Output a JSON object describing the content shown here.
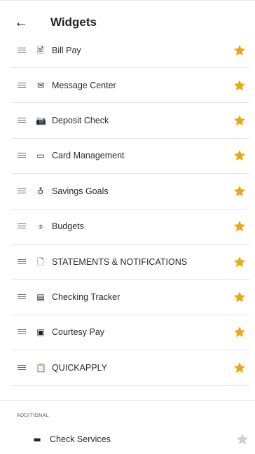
{
  "header": {
    "title": "Widgets",
    "back_icon": "arrow-left-icon"
  },
  "colors": {
    "star_active": "#E8A917",
    "star_inactive": "#CFCFCF",
    "divider": "#E2E2E2"
  },
  "widgets": [
    {
      "label": "Bill Pay",
      "icon": "bill-pay-icon",
      "glyph": "🖹",
      "favorite": true
    },
    {
      "label": "Message Center",
      "icon": "envelope-icon",
      "glyph": "✉",
      "favorite": true
    },
    {
      "label": "Deposit Check",
      "icon": "camera-icon",
      "glyph": "📷",
      "favorite": true
    },
    {
      "label": "Card Management",
      "icon": "credit-card-icon",
      "glyph": "▭",
      "favorite": true
    },
    {
      "label": "Savings Goals",
      "icon": "piggy-bank-icon",
      "glyph": "♁",
      "favorite": true
    },
    {
      "label": "Budgets",
      "icon": "budget-icon",
      "glyph": "⌽",
      "favorite": true
    },
    {
      "label": "STATEMENTS & NOTIFICATIONS",
      "icon": "document-icon",
      "glyph": "🗋",
      "favorite": true
    },
    {
      "label": "Checking Tracker",
      "icon": "tracker-icon",
      "glyph": "▤",
      "favorite": true
    },
    {
      "label": "Courtesy Pay",
      "icon": "money-icon",
      "glyph": "▣",
      "favorite": true
    },
    {
      "label": "QUICKAPPLY",
      "icon": "clipboard-icon",
      "glyph": "📋",
      "favorite": true
    }
  ],
  "additional": {
    "section_label": "ADDITIONAL",
    "items": [
      {
        "label": "Check Services",
        "icon": "check-icon",
        "glyph": "▬",
        "favorite": false
      }
    ]
  }
}
